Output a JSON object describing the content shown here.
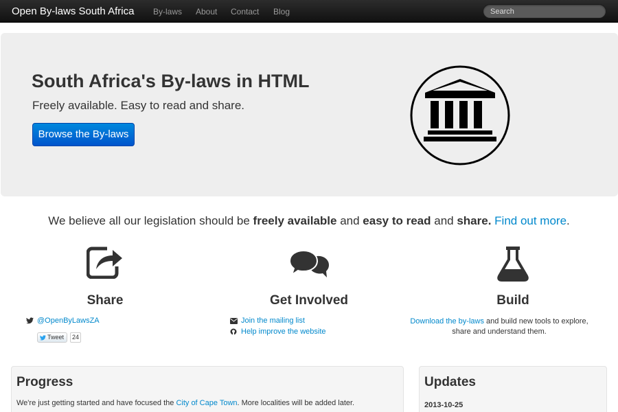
{
  "navbar": {
    "brand": "Open By-laws South Africa",
    "links": [
      "By-laws",
      "About",
      "Contact",
      "Blog"
    ],
    "search_placeholder": "Search"
  },
  "hero": {
    "title": "South Africa's By-laws in HTML",
    "subtitle": "Freely available. Easy to read and share.",
    "button_label": "Browse the By-laws",
    "logo_icon": "building-columns-icon"
  },
  "tagline": {
    "part1": "We believe all our legislation should be ",
    "bold1": "freely available",
    "part2": " and ",
    "bold2": "easy to read",
    "part3": " and ",
    "bold3": "share.",
    "link": "Find out more",
    "end": "."
  },
  "features": {
    "share": {
      "icon": "share-icon",
      "title": "Share",
      "twitter_handle": "@OpenByLawsZA",
      "tweet_label": "Tweet",
      "tweet_count": "24"
    },
    "involved": {
      "icon": "chat-bubbles-icon",
      "title": "Get Involved",
      "mailing_link": "Join the mailing list",
      "improve_link": "Help improve the website"
    },
    "build": {
      "icon": "flask-icon",
      "title": "Build",
      "download_link": "Download the by-laws",
      "text_rest": " and build new tools to explore, share and understand them."
    }
  },
  "progress": {
    "title": "Progress",
    "text_before": "We're just getting started and have focused the ",
    "link": "City of Cape Town",
    "text_after": ". More localities will be added later."
  },
  "updates": {
    "title": "Updates",
    "date": "2013-10-25"
  },
  "colors": {
    "accent": "#0088cc",
    "button": "#0066cc",
    "hero_bg": "#eeeeee",
    "navbar_bg": "#1b1b1b"
  }
}
